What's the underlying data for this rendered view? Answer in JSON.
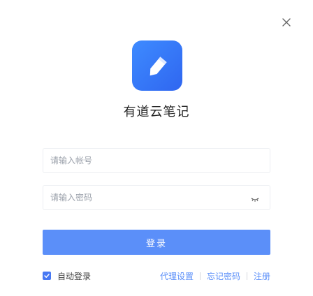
{
  "window": {
    "close_icon": "close-icon"
  },
  "brand": {
    "logo_icon": "pencil-note-icon",
    "app_name": "有道云笔记",
    "accent_color": "#5b8ff9",
    "logo_color": "#3b7bf7"
  },
  "form": {
    "account_placeholder": "请输入帐号",
    "password_placeholder": "请输入密码",
    "password_toggle_icon": "eye-closed-icon",
    "login_label": "登录"
  },
  "footer": {
    "remember_label": "自动登录",
    "remember_checked": true,
    "links": [
      "代理设置",
      "忘记密码",
      "注册"
    ]
  }
}
